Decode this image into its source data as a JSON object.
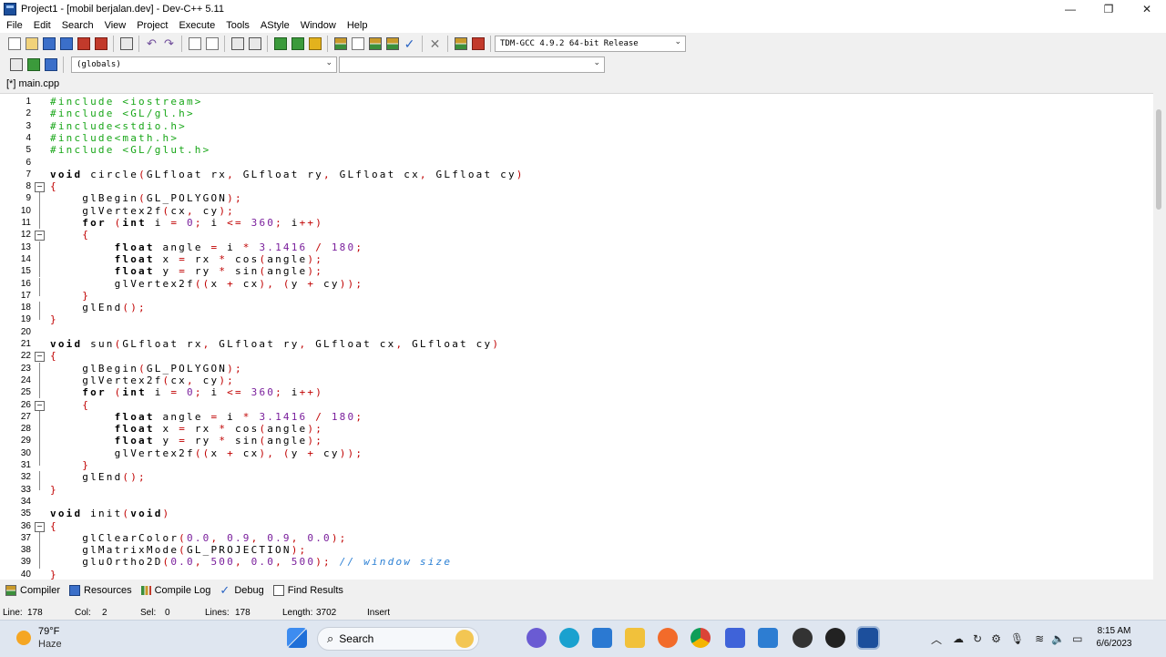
{
  "window": {
    "title": "Project1 - [mobil berjalan.dev] - Dev-C++ 5.11",
    "controls": [
      "—",
      "❐",
      "✕"
    ]
  },
  "menu": [
    "File",
    "Edit",
    "Search",
    "View",
    "Project",
    "Execute",
    "Tools",
    "AStyle",
    "Window",
    "Help"
  ],
  "toolbar": {
    "compiler_select": "TDM-GCC 4.9.2 64-bit Release",
    "scope_select": "(globals)",
    "member_select": ""
  },
  "file_tab": "[*] main.cpp",
  "editor": {
    "lines": [
      "#include <iostream>",
      "#include <GL/gl.h>",
      "#include<stdio.h>",
      "#include<math.h>",
      "#include <GL/glut.h>",
      "",
      "void circle(GLfloat rx, GLfloat ry, GLfloat cx, GLfloat cy)",
      "{",
      "    glBegin(GL_POLYGON);",
      "    glVertex2f(cx, cy);",
      "    for (int i = 0; i <= 360; i++)",
      "    {",
      "        float angle = i * 3.1416 / 180;",
      "        float x = rx * cos(angle);",
      "        float y = ry * sin(angle);",
      "        glVertex2f((x + cx), (y + cy));",
      "    }",
      "    glEnd();",
      "}",
      "",
      "void sun(GLfloat rx, GLfloat ry, GLfloat cx, GLfloat cy)",
      "{",
      "    glBegin(GL_POLYGON);",
      "    glVertex2f(cx, cy);",
      "    for (int i = 0; i <= 360; i++)",
      "    {",
      "        float angle = i * 3.1416 / 180;",
      "        float x = rx * cos(angle);",
      "        float y = ry * sin(angle);",
      "        glVertex2f((x + cx), (y + cy));",
      "    }",
      "    glEnd();",
      "}",
      "",
      "void init(void)",
      "{",
      "    glClearColor(0.0, 0.9, 0.9, 0.0);",
      "    glMatrixMode(GL_PROJECTION);",
      "    gluOrtho2D(0.0, 500, 0.0, 500); // window size",
      "}"
    ]
  },
  "bottom_tabs": [
    "Compiler",
    "Resources",
    "Compile Log",
    "Debug",
    "Find Results"
  ],
  "status": {
    "line_label": "Line:",
    "line_value": "178",
    "col_label": "Col:",
    "col_value": "2",
    "sel_label": "Sel:",
    "sel_value": "0",
    "lines_label": "Lines:",
    "lines_value": "178",
    "length_label": "Length:",
    "length_value": "3702",
    "mode": "Insert"
  },
  "taskbar": {
    "temperature": "79°F",
    "weather": "Haze",
    "search_placeholder": "Search",
    "time": "8:15 AM",
    "date": "6/6/2023"
  },
  "colors": {
    "preprocessor": "#17a617",
    "symbol": "#c00000",
    "number": "#7a1f9c",
    "comment": "#2a7fd4"
  }
}
